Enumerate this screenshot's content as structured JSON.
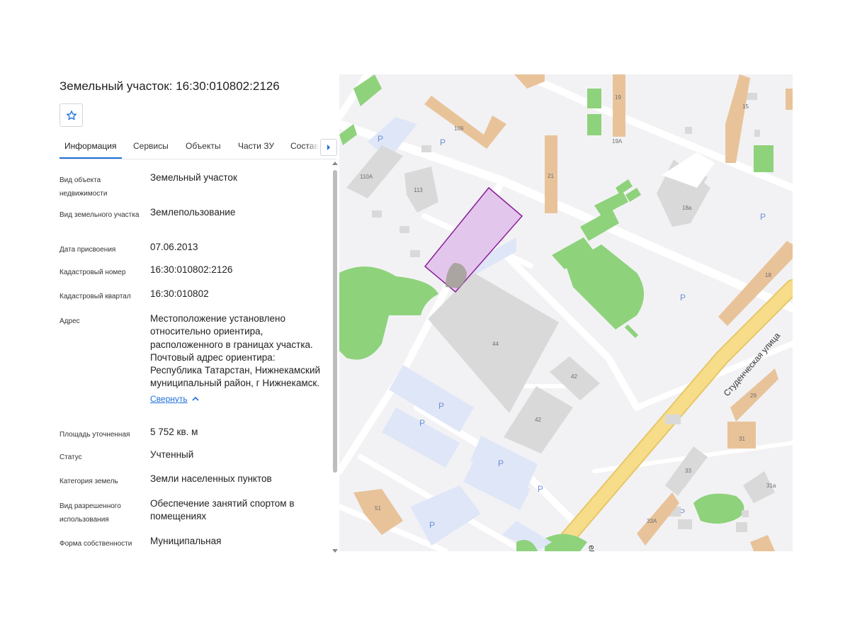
{
  "title": "Земельный участок: 16:30:010802:2126",
  "tabs": [
    {
      "label": "Информация"
    },
    {
      "label": "Сервисы"
    },
    {
      "label": "Объекты"
    },
    {
      "label": "Части ЗУ"
    },
    {
      "label": "Состав"
    }
  ],
  "details": [
    {
      "label": "Вид объекта недвижимости",
      "value": "Земельный участок"
    },
    {
      "label": "Вид земельного участка",
      "value": "Землепользование"
    },
    {
      "label": "Дата присвоения",
      "value": "07.06.2013"
    },
    {
      "label": "Кадастровый номер",
      "value": "16:30:010802:2126"
    },
    {
      "label": "Кадастровый квартал",
      "value": "16:30:010802"
    },
    {
      "label": "Адрес",
      "value": "Местоположение установлено относительно ориентира, расположенного в границах участка. Почтовый адрес ориентира: Республика Татарстан, Нижнекамский муниципальный район, г Нижнекамск."
    },
    {
      "label": "Площадь уточненная",
      "value": "5 752 кв. м"
    },
    {
      "label": "Статус",
      "value": "Учтенный"
    },
    {
      "label": "Категория земель",
      "value": "Земли населенных пунктов"
    },
    {
      "label": "Вид разрешенного использования",
      "value": "Обеспечение занятий спортом в помещениях"
    },
    {
      "label": "Форма собственности",
      "value": "Муниципальная"
    }
  ],
  "address_toggle": "Свернуть",
  "map": {
    "street_name": "Студенческая улица",
    "street_fragment": "ел",
    "parking_symbol": "P",
    "house_numbers": [
      "15",
      "19",
      "19А",
      "109",
      "110А",
      "113",
      "21",
      "18а",
      "18",
      "44",
      "42",
      "42",
      "29",
      "31",
      "33",
      "31а",
      "33А",
      "51"
    ]
  },
  "colors": {
    "accent": "#1e6fd9",
    "parcel_fill": "#e3c6ec",
    "parcel_stroke": "#8a1f9a",
    "green": "#8ed27c",
    "road_yellow": "#f7dc8a",
    "building_orange": "#e8c39a"
  }
}
